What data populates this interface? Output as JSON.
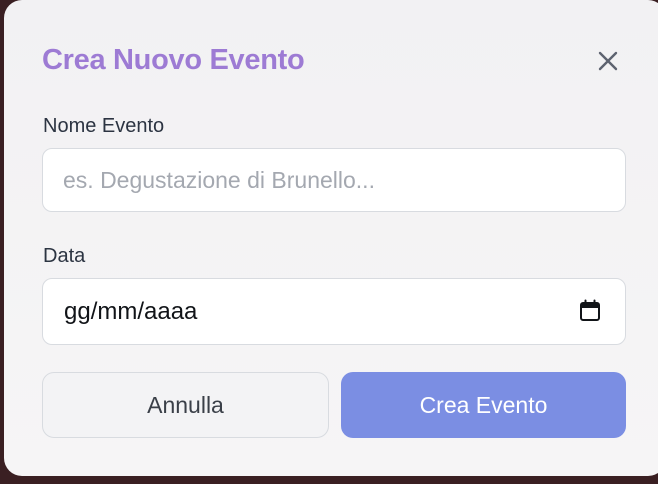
{
  "modal": {
    "title": "Crea Nuovo Evento",
    "close_icon": "close-icon"
  },
  "form": {
    "name_label": "Nome Evento",
    "name_placeholder": "es. Degustazione di Brunello...",
    "name_value": "",
    "date_label": "Data",
    "date_value": "gg/mm/aaaa",
    "date_icon": "calendar-icon"
  },
  "actions": {
    "cancel_label": "Annulla",
    "create_label": "Crea Evento"
  },
  "colors": {
    "title": "#9d7bd4",
    "primary_button": "#7b8ee3",
    "backdrop": "#3a1f22"
  }
}
